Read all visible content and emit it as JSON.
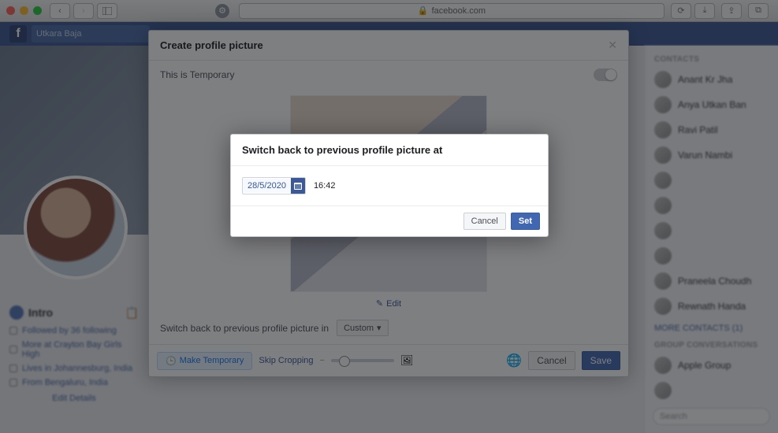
{
  "browser": {
    "url_label": "facebook.com"
  },
  "fb": {
    "logo_letter": "f",
    "search_placeholder": "Utkara Baja"
  },
  "profile": {
    "intro_title": "Intro",
    "intro_lines": [
      "Followed by 36 following",
      "More at Crayton Bay Girls High",
      "Lives in Johannesburg, India",
      "From Bengaluru, India"
    ],
    "edit_details": "Edit Details"
  },
  "contacts": {
    "header": "CONTACTS",
    "items": [
      "Anant Kr Jha",
      "Anya Utkan Ban",
      "Ravi Patil",
      "Varun Nambi",
      "",
      "",
      "",
      "",
      "Praneela Choudh",
      "Rewnath Handa"
    ],
    "more": "MORE CONTACTS (1)",
    "groups_header": "GROUP CONVERSATIONS",
    "group_items": [
      "Apple Group",
      ""
    ],
    "search_placeholder": "Search"
  },
  "modal1": {
    "title": "Create profile picture",
    "temp_label": "This is Temporary",
    "edit_label": "Edit",
    "switch_label": "Switch back to previous profile picture in",
    "dropdown_label": "Custom",
    "make_temporary": "Make Temporary",
    "skip_cropping": "Skip Cropping",
    "cancel": "Cancel",
    "save": "Save"
  },
  "modal2": {
    "title": "Switch back to previous profile picture at",
    "date": "28/5/2020",
    "time": "16:42",
    "cancel": "Cancel",
    "set": "Set"
  }
}
